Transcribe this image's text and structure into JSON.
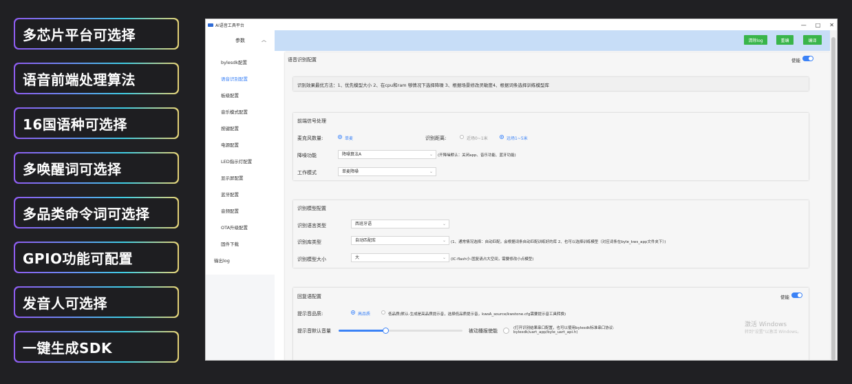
{
  "features": [
    "多芯片平台可选择",
    "语音前端处理算法",
    "16国语种可选择",
    "多唤醒词可选择",
    "多品类命令词可选择",
    "GPIO功能可配置",
    "发音人可选择",
    "一键生成SDK"
  ],
  "window": {
    "title": "AI语音工具平台",
    "controls": {
      "minimize": "—",
      "maximize": "□",
      "close": "✕"
    }
  },
  "sidebar": {
    "header": "参数",
    "items": [
      "bylesdk配置",
      "语音识别配置",
      "板级配置",
      "音乐模式配置",
      "按键配置",
      "电源配置",
      "LED指示灯配置",
      "显示屏配置",
      "蓝牙配置",
      "音频配置",
      "OTA升级配置",
      "固件下载"
    ],
    "log": "输出log"
  },
  "toolbar": {
    "clear_log": "清除log",
    "reset": "重编",
    "compile": "编译"
  },
  "asr": {
    "title": "语音识别配置",
    "enable_label": "使能",
    "tip": "识别效果最优方法：1、优先模型大小 2、在cpu和ram 够情况下选择降噪 3、根据场景修改灵敏度4、根据词条选择训练模型库"
  },
  "frontend": {
    "title": "前端信号处理",
    "mic_label": "麦克风数量:",
    "mic_option": "单麦",
    "distance_label": "识别距离:",
    "distance_near": "近场0~1米",
    "distance_far": "远场1~5米",
    "noise_label": "降噪功能",
    "noise_value": "降噪算法A",
    "noise_hint": "(开降噪默认：关闭app、音乐功能、蓝牙功能)",
    "mode_label": "工作模式",
    "mode_value": "单麦降噪"
  },
  "model": {
    "title": "识别模型配置",
    "lang_label": "识别语言类型",
    "lang_value": "西班牙语",
    "lib_label": "识别库类型",
    "lib_value": "自动匹配库",
    "lib_hint": "(1、通常情况选择：自动匹配，会根据词条自动匹配训练好的库 2、也可以选择训练模型（对应词条在byle_kws_app文件夹下）)",
    "size_label": "识别模型大小",
    "size_value": "大",
    "size_hint": "(IC-flash小-固复请占大空间，需要修改小点模型)"
  },
  "reply": {
    "title": "回复语配置",
    "enable_label": "使能",
    "quality_label": "提示音品质:",
    "quality_high": "高品质",
    "quality_low": "低品质(默认-生成是高品质提示音，选择低品质提示音，kwsA_source/kwstone.cfg需要提示音工具转换)",
    "volume_label": "提示音默认音量",
    "volume_fraction": 0.38,
    "passive_label": "被动播报使能",
    "passive_hint": "(打开识别结果串口配置，也可以使用bylesdk标准串口协议:",
    "passive_hint2": "bylesdk/uart_app/byle_uart_api.h)"
  },
  "watermark": {
    "line1": "激活 Windows",
    "line2": "转到\"设置\"以激活 Windows。"
  }
}
